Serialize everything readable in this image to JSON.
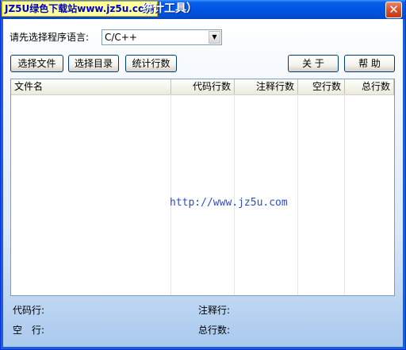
{
  "window": {
    "watermark": "JZ5U绿色下载站www.jz5u.com",
    "title": "统计工具）"
  },
  "language": {
    "label": "请先选择程序语言:",
    "selected": "C/C++"
  },
  "toolbar": {
    "select_file": "选择文件",
    "select_dir": "选择目录",
    "count_lines": "统计行数",
    "about": "关 于",
    "help": "帮 助"
  },
  "list": {
    "columns": [
      "文件名",
      "代码行数",
      "注释行数",
      "空行数",
      "总行数"
    ],
    "rows": [],
    "watermark_url": "http://www.jz5u.com"
  },
  "stats": {
    "code_label": "代码行:",
    "code_value": "",
    "comment_label": "注释行:",
    "comment_value": "",
    "blank_label": "空　行:",
    "blank_value": "",
    "total_label": "总行数:",
    "total_value": ""
  }
}
